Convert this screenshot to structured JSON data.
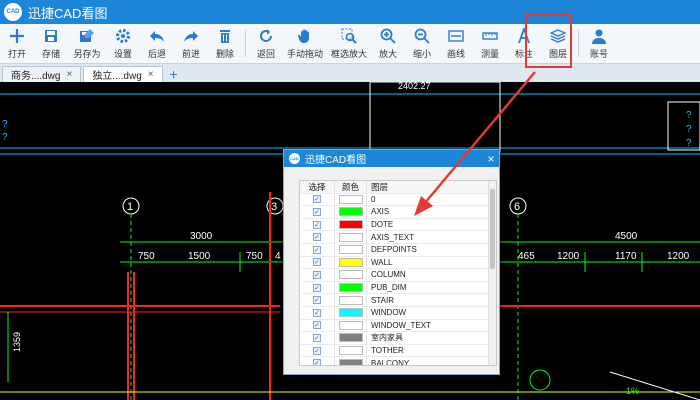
{
  "app": {
    "title": "迅捷CAD看图",
    "logo_text": "CAD"
  },
  "toolbar": [
    {
      "id": "open",
      "label": "打开",
      "icon": "plus-icon"
    },
    {
      "id": "save",
      "label": "存储",
      "icon": "save-icon"
    },
    {
      "id": "saveas",
      "label": "另存为",
      "icon": "save-as-icon"
    },
    {
      "id": "settings",
      "label": "设置",
      "icon": "gear-icon"
    },
    {
      "id": "back",
      "label": "后退",
      "icon": "undo-icon"
    },
    {
      "id": "forward",
      "label": "前进",
      "icon": "redo-icon"
    },
    {
      "id": "delete",
      "label": "删除",
      "icon": "trash-icon"
    },
    {
      "id": "return",
      "label": "返回",
      "icon": "return-icon"
    },
    {
      "id": "pan",
      "label": "手动拖动",
      "icon": "hand-icon"
    },
    {
      "id": "zoomwindow",
      "label": "框选放大",
      "icon": "zoom-window-icon"
    },
    {
      "id": "zoomin",
      "label": "放大",
      "icon": "zoom-in-icon"
    },
    {
      "id": "zoomout",
      "label": "缩小",
      "icon": "zoom-out-icon"
    },
    {
      "id": "line",
      "label": "画线",
      "icon": "line-icon"
    },
    {
      "id": "measure",
      "label": "测量",
      "icon": "ruler-icon"
    },
    {
      "id": "annotate",
      "label": "标注",
      "icon": "text-a-icon"
    },
    {
      "id": "layers",
      "label": "图层",
      "icon": "layers-icon"
    },
    {
      "id": "account",
      "label": "账号",
      "icon": "user-icon"
    }
  ],
  "tabs": [
    {
      "label": "商务....dwg",
      "active": false
    },
    {
      "label": "独立....dwg",
      "active": true
    }
  ],
  "drawing": {
    "dim_top": "2402.27",
    "axis_labels": [
      "1",
      "3",
      "6"
    ],
    "dims_row1": [
      "3000",
      "4500"
    ],
    "dims_row2": [
      "750",
      "1500",
      "750",
      "4",
      "465",
      "1200",
      "1170",
      "1200"
    ],
    "dim_vertical": "1359",
    "left_marks": [
      "?",
      "?"
    ],
    "right_marks": [
      "?",
      "?",
      "?"
    ],
    "bottom_right_text": "1%"
  },
  "dialog": {
    "title": "迅捷CAD看图",
    "close": "×",
    "columns": {
      "select": "选择",
      "color": "颜色",
      "layer": "图层"
    },
    "layers": [
      {
        "name": "0",
        "color": "#ffffff"
      },
      {
        "name": "AXIS",
        "color": "#00ff00"
      },
      {
        "name": "DOTE",
        "color": "#ff0000"
      },
      {
        "name": "AXIS_TEXT",
        "color": "#ffffff"
      },
      {
        "name": "DEFPOINTS",
        "color": "#ffffff"
      },
      {
        "name": "WALL",
        "color": "#ffff00"
      },
      {
        "name": "COLUMN",
        "color": "#ffffff"
      },
      {
        "name": "PUB_DIM",
        "color": "#00ff00"
      },
      {
        "name": "STAIR",
        "color": "#ffffff"
      },
      {
        "name": "WINDOW",
        "color": "#00ffff"
      },
      {
        "name": "WINDOW_TEXT",
        "color": "#ffffff"
      },
      {
        "name": "室内家具",
        "color": "#808080"
      },
      {
        "name": "TOTHER",
        "color": "#ffffff"
      },
      {
        "name": "BALCONY",
        "color": "#808080"
      }
    ]
  },
  "colors": {
    "accent": "#1e86d8",
    "highlight": "#e53935",
    "arrow": "#e53935"
  }
}
